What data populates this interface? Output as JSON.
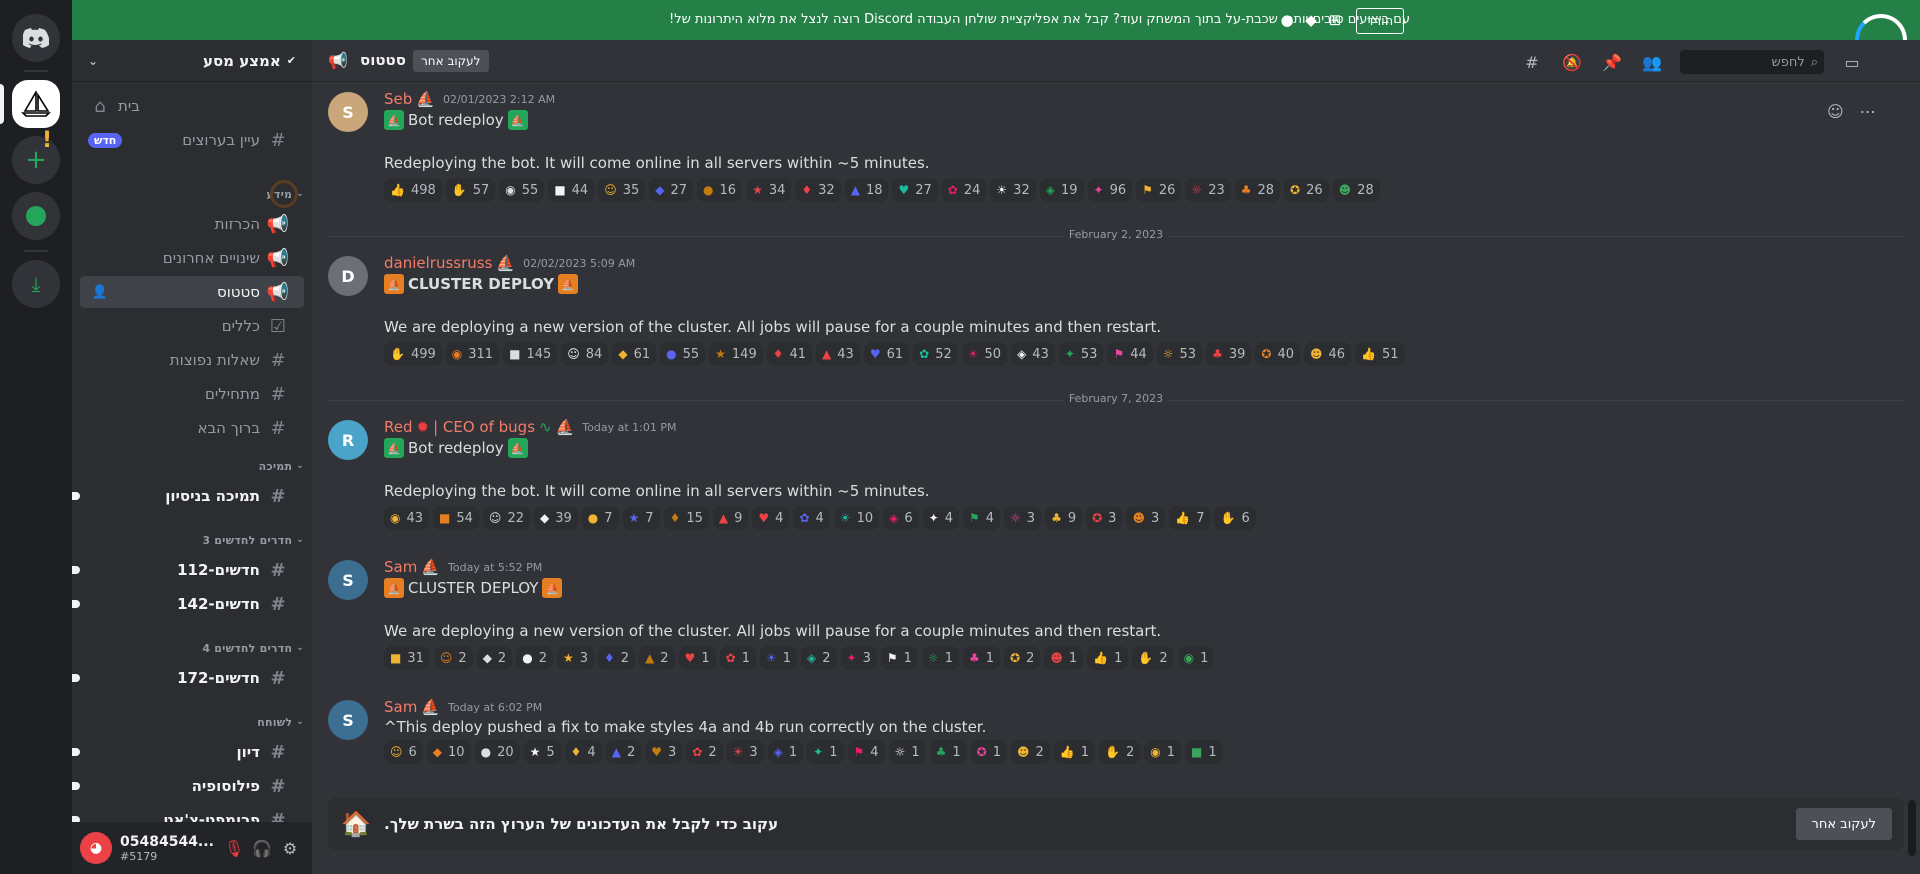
{
  "banner": {
    "text": "עם ביצועים טובים יותר, שכבת-על בתוך המשחק ועוד? קבל את אפליקציית שולחן העבודה Discord רוצה לנצל את מלוא היתרונות של!",
    "download_label": "הורד"
  },
  "server": {
    "name": "אמצע מסע"
  },
  "channels": {
    "home": "בית",
    "browse": "עיין בערוצים",
    "new_badge": "חדש",
    "cat_info": "מידע",
    "announcements": "הכרזות",
    "recent_changes": "שינויים אחרונים",
    "status": "סטטוס",
    "rules": "כללים",
    "faq": "שאלות נפוצות",
    "getting_started": "מתחילים",
    "welcome": "ברוך הבא",
    "cat_support": "תמיכה",
    "trial_support": "תמיכה בניסיון",
    "cat_newbies3": "חדרים לחדשים 3",
    "newbies112": "חדשים-112",
    "newbies142": "חדשים-142",
    "cat_newbies4": "חדרים לחדשים 4",
    "newbies172": "חדשים-172",
    "cat_chat": "לשוחח",
    "discussion": "דיון",
    "philosophy": "פילוסופיה",
    "prompt_chat": "פרומפט-צ'אט"
  },
  "user": {
    "name": "05484544...",
    "tag": "#5179"
  },
  "header": {
    "channel": "סטטוס",
    "follow_label": "לעקוב אחר",
    "search_placeholder": "לחפש"
  },
  "messages": [
    {
      "author": "Seb",
      "time": "02/01/2023 2:12 AM",
      "line1": "Bot redeploy",
      "line2": "Redeploying the bot. It will come online in all servers within ~5 minutes.",
      "reactions": [
        "498",
        "57",
        "55",
        "44",
        "35",
        "27",
        "16",
        "34",
        "32",
        "18",
        "27",
        "24",
        "32",
        "19",
        "96",
        "26",
        "23",
        "28",
        "26",
        "28"
      ]
    },
    {
      "author": "danielrussruss",
      "time": "02/02/2023 5:09 AM",
      "line1": "CLUSTER DEPLOY",
      "line2": "We are deploying a new version of the cluster. All jobs will pause for a couple minutes and then restart.",
      "reactions": [
        "499",
        "311",
        "145",
        "84",
        "61",
        "55",
        "149",
        "41",
        "43",
        "61",
        "52",
        "50",
        "43",
        "53",
        "44",
        "53",
        "39",
        "40",
        "46",
        "51"
      ]
    },
    {
      "author": "Red",
      "author_suffix": "| CEO of bugs",
      "time": "Today at 1:01 PM",
      "line1": "Bot redeploy",
      "line2": "Redeploying the bot. It will come online in all servers within ~5 minutes.",
      "reactions": [
        "43",
        "54",
        "22",
        "39",
        "7",
        "7",
        "15",
        "9",
        "4",
        "4",
        "10",
        "6",
        "4",
        "4",
        "3",
        "9",
        "3",
        "3",
        "7",
        "6"
      ]
    },
    {
      "author": "Sam",
      "time": "Today at 5:52 PM",
      "line1": "CLUSTER DEPLOY",
      "line2": "We are deploying a new version of the cluster. All jobs will pause for a couple minutes and then restart.",
      "reactions": [
        "31",
        "2",
        "2",
        "2",
        "3",
        "2",
        "2",
        "1",
        "1",
        "1",
        "2",
        "3",
        "1",
        "1",
        "1",
        "2",
        "1",
        "1",
        "2",
        "1"
      ]
    },
    {
      "author": "Sam",
      "time": "Today at 6:02 PM",
      "line1": "^This deploy pushed a fix to make styles 4a and 4b run correctly on the cluster.",
      "reactions": [
        "6",
        "10",
        "20",
        "5",
        "4",
        "2",
        "3",
        "2",
        "3",
        "1",
        "1",
        "4",
        "1",
        "1",
        "1",
        "2",
        "1",
        "2",
        "1",
        "1"
      ]
    }
  ],
  "dividers": [
    "February 2, 2023",
    "February 7, 2023"
  ],
  "follow_bar": {
    "text": "עקוב כדי לקבל את העדכונים של הערוץ הזה בשרת שלך.",
    "button": "לעקוב אחר"
  },
  "colors": {
    "accent": "#5865f2",
    "green": "#248046",
    "author": "#f47b67"
  }
}
